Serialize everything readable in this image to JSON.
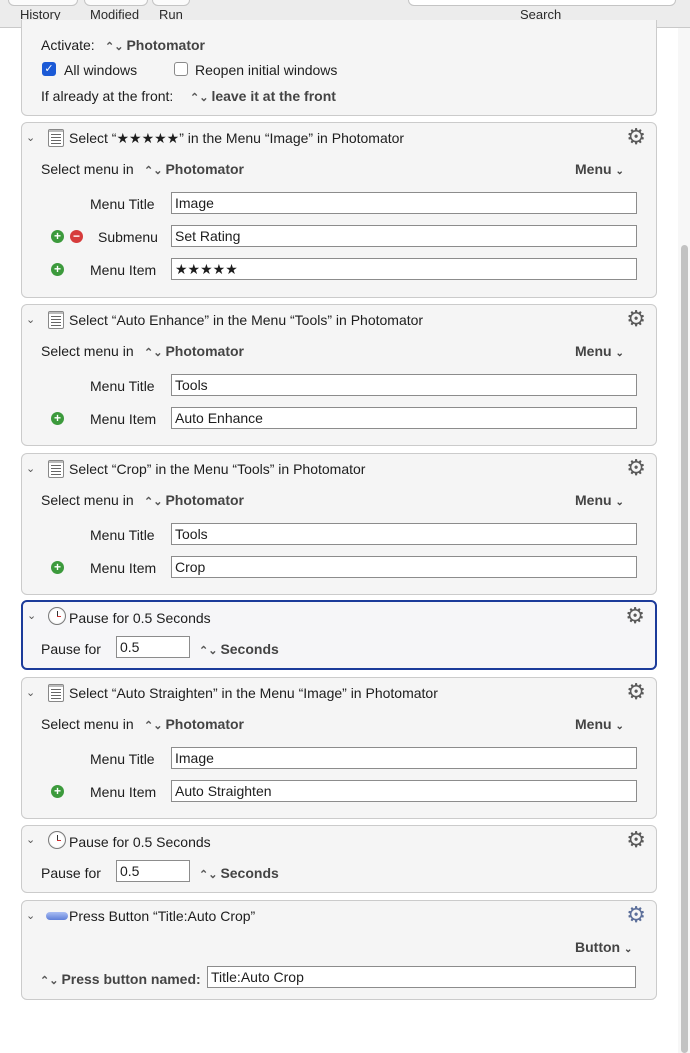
{
  "toolbar": {
    "history_label": "History",
    "modified_label": "Modified",
    "run_label": "Run",
    "search_label": "Search"
  },
  "activate_block": {
    "activate_label": "Activate:",
    "activate_app": "Photomator",
    "all_windows_label": "All windows",
    "all_windows_checked": true,
    "reopen_label": "Reopen initial windows",
    "reopen_checked": false,
    "front_label": "If already at the front:",
    "front_value": "leave it at the front"
  },
  "actions": [
    {
      "title": "Select “★★★★★” in the Menu “Image” in Photomator",
      "select_label": "Select menu in",
      "app": "Photomator",
      "menu_label": "Menu",
      "menu_title_label": "Menu Title",
      "menu_title_value": "Image",
      "submenu_label": "Submenu",
      "submenu_value": "Set Rating",
      "menu_item_label": "Menu Item",
      "menu_item_value": "★★★★★"
    },
    {
      "title": "Select “Auto Enhance” in the Menu “Tools” in Photomator",
      "select_label": "Select menu in",
      "app": "Photomator",
      "menu_label": "Menu",
      "menu_title_label": "Menu Title",
      "menu_title_value": "Tools",
      "menu_item_label": "Menu Item",
      "menu_item_value": "Auto Enhance"
    },
    {
      "title": "Select “Crop” in the Menu “Tools” in Photomator",
      "select_label": "Select menu in",
      "app": "Photomator",
      "menu_label": "Menu",
      "menu_title_label": "Menu Title",
      "menu_title_value": "Tools",
      "menu_item_label": "Menu Item",
      "menu_item_value": "Crop"
    },
    {
      "title": "Pause for 0.5 Seconds",
      "pause_label": "Pause for",
      "pause_value": "0.5",
      "unit": "Seconds"
    },
    {
      "title": "Select “Auto Straighten” in the Menu “Image” in Photomator",
      "select_label": "Select menu in",
      "app": "Photomator",
      "menu_label": "Menu",
      "menu_title_label": "Menu Title",
      "menu_title_value": "Image",
      "menu_item_label": "Menu Item",
      "menu_item_value": "Auto Straighten"
    },
    {
      "title": "Pause for 0.5 Seconds",
      "pause_label": "Pause for",
      "pause_value": "0.5",
      "unit": "Seconds"
    },
    {
      "title": "Press Button “Title:Auto Crop”",
      "button_menu_label": "Button",
      "press_label": "Press button named:",
      "press_value": "Title:Auto Crop"
    }
  ],
  "icons": {
    "chevron": "chevron-down-icon",
    "gear": "gear-icon",
    "menu": "menu-action-icon",
    "clock": "clock-icon",
    "button": "button-action-icon",
    "add": "plus-icon",
    "remove": "minus-icon"
  },
  "colors": {
    "selected_border": "#1c3b9a",
    "checkbox_on": "#1b5ad6",
    "add_green": "#3c9a3c",
    "remove_red": "#d63b3b"
  }
}
